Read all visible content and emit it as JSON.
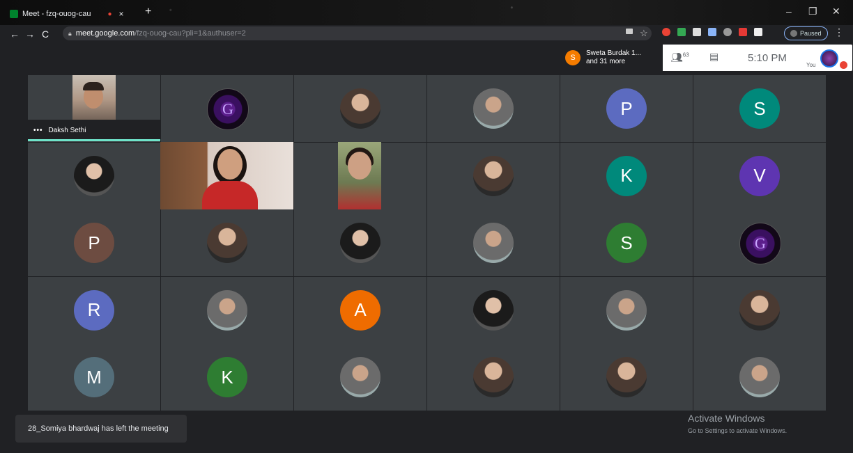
{
  "browser": {
    "tab_title": "Meet - fzq-ouog-cau",
    "tab_close": "×",
    "new_tab": "+",
    "url_host": "meet.google.com",
    "url_path": "/fzq-ouog-cau?pli=1&authuser=2",
    "profile_status": "Paused",
    "nav_back": "←",
    "nav_forward": "→",
    "nav_reload": "C",
    "menu": "⋮",
    "minimize": "–",
    "restore": "❐",
    "close": "✕",
    "bookmark": "☆"
  },
  "meet": {
    "presenter_initial": "S",
    "presenter_line1": "Sweta Burdak 1...",
    "presenter_line2": "and 31 more",
    "participant_count": "63",
    "time": "5:10 PM",
    "you_label": "You"
  },
  "speaker": {
    "name": "Daksh Sethi",
    "menu": "•••"
  },
  "tiles": [
    {
      "type": "video",
      "initial": ""
    },
    {
      "type": "logo",
      "initial": ""
    },
    {
      "type": "photo",
      "initial": ""
    },
    {
      "type": "photo3",
      "initial": ""
    },
    {
      "type": "letter",
      "initial": "P",
      "color": "#5c6bc0"
    },
    {
      "type": "letter",
      "initial": "S",
      "color": "#00897b"
    },
    {
      "type": "photo2",
      "initial": ""
    },
    {
      "type": "video",
      "initial": ""
    },
    {
      "type": "video",
      "initial": ""
    },
    {
      "type": "photo",
      "initial": ""
    },
    {
      "type": "letter",
      "initial": "K",
      "color": "#00897b"
    },
    {
      "type": "letter",
      "initial": "V",
      "color": "#5e35b1"
    },
    {
      "type": "letter",
      "initial": "P",
      "color": "#6d4c41"
    },
    {
      "type": "photo",
      "initial": ""
    },
    {
      "type": "photo2",
      "initial": ""
    },
    {
      "type": "photo3",
      "initial": ""
    },
    {
      "type": "letter",
      "initial": "S",
      "color": "#2e7d32"
    },
    {
      "type": "logo",
      "initial": ""
    },
    {
      "type": "letter",
      "initial": "R",
      "color": "#5c6bc0"
    },
    {
      "type": "photo3",
      "initial": ""
    },
    {
      "type": "letter",
      "initial": "A",
      "color": "#ef6c00"
    },
    {
      "type": "photo2",
      "initial": ""
    },
    {
      "type": "photo3",
      "initial": ""
    },
    {
      "type": "photo",
      "initial": ""
    },
    {
      "type": "letter",
      "initial": "M",
      "color": "#546e7a"
    },
    {
      "type": "letter",
      "initial": "K",
      "color": "#2e7d32"
    },
    {
      "type": "photo3",
      "initial": ""
    },
    {
      "type": "photo",
      "initial": ""
    },
    {
      "type": "photo",
      "initial": ""
    },
    {
      "type": "photo3",
      "initial": ""
    }
  ],
  "notification": "28_Somiya bhardwaj has left the meeting",
  "watermark": {
    "line1": "Activate Windows",
    "line2": "Go to Settings to activate Windows."
  }
}
